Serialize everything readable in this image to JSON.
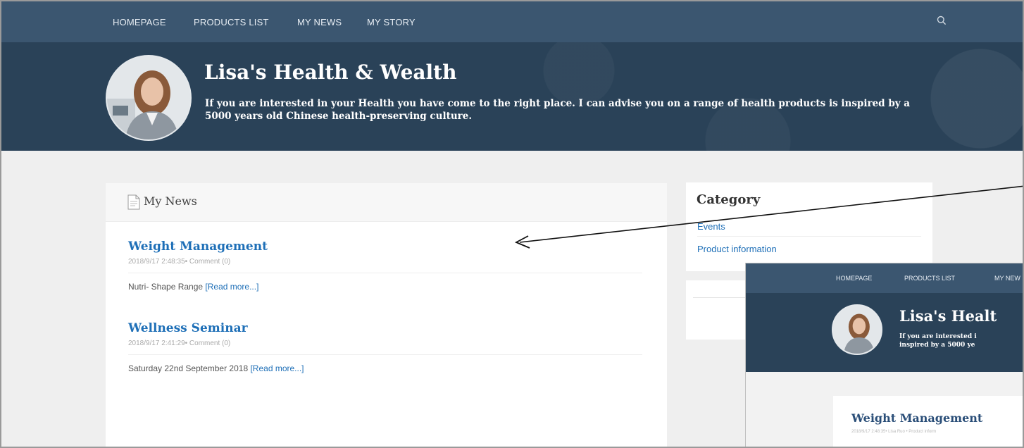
{
  "nav": {
    "items": [
      "HOMEPAGE",
      "PRODUCTS LIST",
      "MY NEWS",
      "MY STORY"
    ],
    "search_icon": "search-icon"
  },
  "hero": {
    "title": "Lisa's Health & Wealth",
    "description": "If you are interested in your Health you have come to the right place. I can advise you on a range of health products is inspired by a 5000 years old Chinese health-preserving culture."
  },
  "news": {
    "heading": "My News",
    "articles": [
      {
        "title": "Weight Management",
        "meta": "2018/9/17 2:48:35• Comment (0)",
        "summary": "Nutri- Shape Range",
        "read_more": "[Read more...]"
      },
      {
        "title": "Wellness Seminar",
        "meta": "2018/9/17 2:41:29• Comment (0)",
        "summary": "Saturday 22nd September 2018",
        "read_more": "[Read more...]"
      }
    ]
  },
  "category": {
    "title": "Category",
    "links": [
      "Events",
      "Product information"
    ]
  },
  "inset": {
    "nav_items": [
      "HOMEPAGE",
      "PRODUCTS LIST",
      "MY NEW"
    ],
    "title": "Lisa's Healt",
    "desc_line1": "If you are interested i",
    "desc_line2": "inspired by a 5000 ye",
    "article_title": "Weight Management",
    "article_meta": "2018/9/17 2:48:35• Lisa Ruo • Product inform"
  },
  "colors": {
    "nav_bg": "#3b5670",
    "hero_bg": "#2a4258",
    "link": "#1e6fb7",
    "page_bg": "#efefef"
  }
}
